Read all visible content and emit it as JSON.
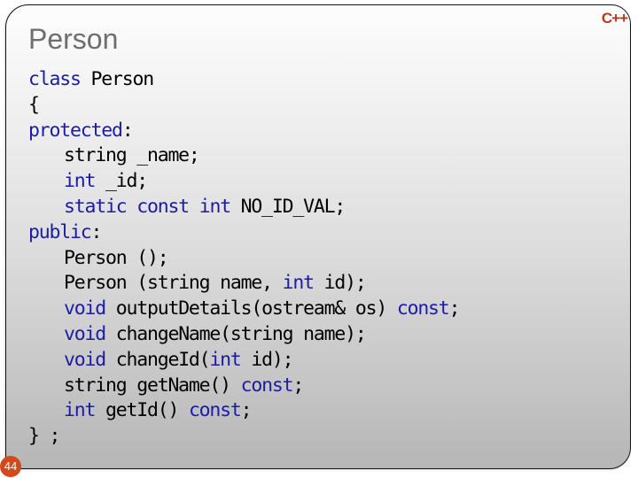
{
  "slide": {
    "title": "Person",
    "logo_text": "C++",
    "page_number": "44",
    "colors": {
      "keyword": "#1b1ba8",
      "text": "#000000",
      "title": "#6e6e6e",
      "logo": "#b5391c",
      "page_badge": "#d04a1c"
    }
  },
  "code": {
    "language": "C++",
    "lines": [
      {
        "indent": 0,
        "tokens": [
          {
            "t": "class",
            "kw": true
          },
          {
            "t": " Person"
          }
        ]
      },
      {
        "indent": 0,
        "tokens": [
          {
            "t": "{"
          }
        ]
      },
      {
        "indent": 0,
        "tokens": [
          {
            "t": "protected",
            "kw": true
          },
          {
            "t": ":"
          }
        ]
      },
      {
        "indent": 1,
        "tokens": [
          {
            "t": "string _name;"
          }
        ]
      },
      {
        "indent": 1,
        "tokens": [
          {
            "t": "int",
            "kw": true
          },
          {
            "t": " _id;"
          }
        ]
      },
      {
        "indent": 1,
        "tokens": [
          {
            "t": "static",
            "kw": true
          },
          {
            "t": " "
          },
          {
            "t": "const",
            "kw": true
          },
          {
            "t": " "
          },
          {
            "t": "int",
            "kw": true
          },
          {
            "t": " NO_ID_VAL;"
          }
        ]
      },
      {
        "indent": 0,
        "tokens": [
          {
            "t": "public",
            "kw": true
          },
          {
            "t": ":"
          }
        ]
      },
      {
        "indent": 1,
        "tokens": [
          {
            "t": "Person ();"
          }
        ]
      },
      {
        "indent": 1,
        "tokens": [
          {
            "t": "Person (string name, "
          },
          {
            "t": "int",
            "kw": true
          },
          {
            "t": " id);"
          }
        ]
      },
      {
        "indent": 1,
        "tokens": [
          {
            "t": "void",
            "kw": true
          },
          {
            "t": " outputDetails(ostream& os) "
          },
          {
            "t": "const",
            "kw": true
          },
          {
            "t": ";"
          }
        ]
      },
      {
        "indent": 1,
        "tokens": [
          {
            "t": "void",
            "kw": true
          },
          {
            "t": " changeName(string name);"
          }
        ]
      },
      {
        "indent": 1,
        "tokens": [
          {
            "t": "void",
            "kw": true
          },
          {
            "t": " changeId("
          },
          {
            "t": "int",
            "kw": true
          },
          {
            "t": " id);"
          }
        ]
      },
      {
        "indent": 1,
        "tokens": [
          {
            "t": "string getName() "
          },
          {
            "t": "const",
            "kw": true
          },
          {
            "t": ";"
          }
        ]
      },
      {
        "indent": 1,
        "tokens": [
          {
            "t": "int",
            "kw": true
          },
          {
            "t": " getId() "
          },
          {
            "t": "const",
            "kw": true
          },
          {
            "t": ";"
          }
        ]
      },
      {
        "indent": 0,
        "tokens": [
          {
            "t": "} ;"
          }
        ]
      }
    ]
  }
}
